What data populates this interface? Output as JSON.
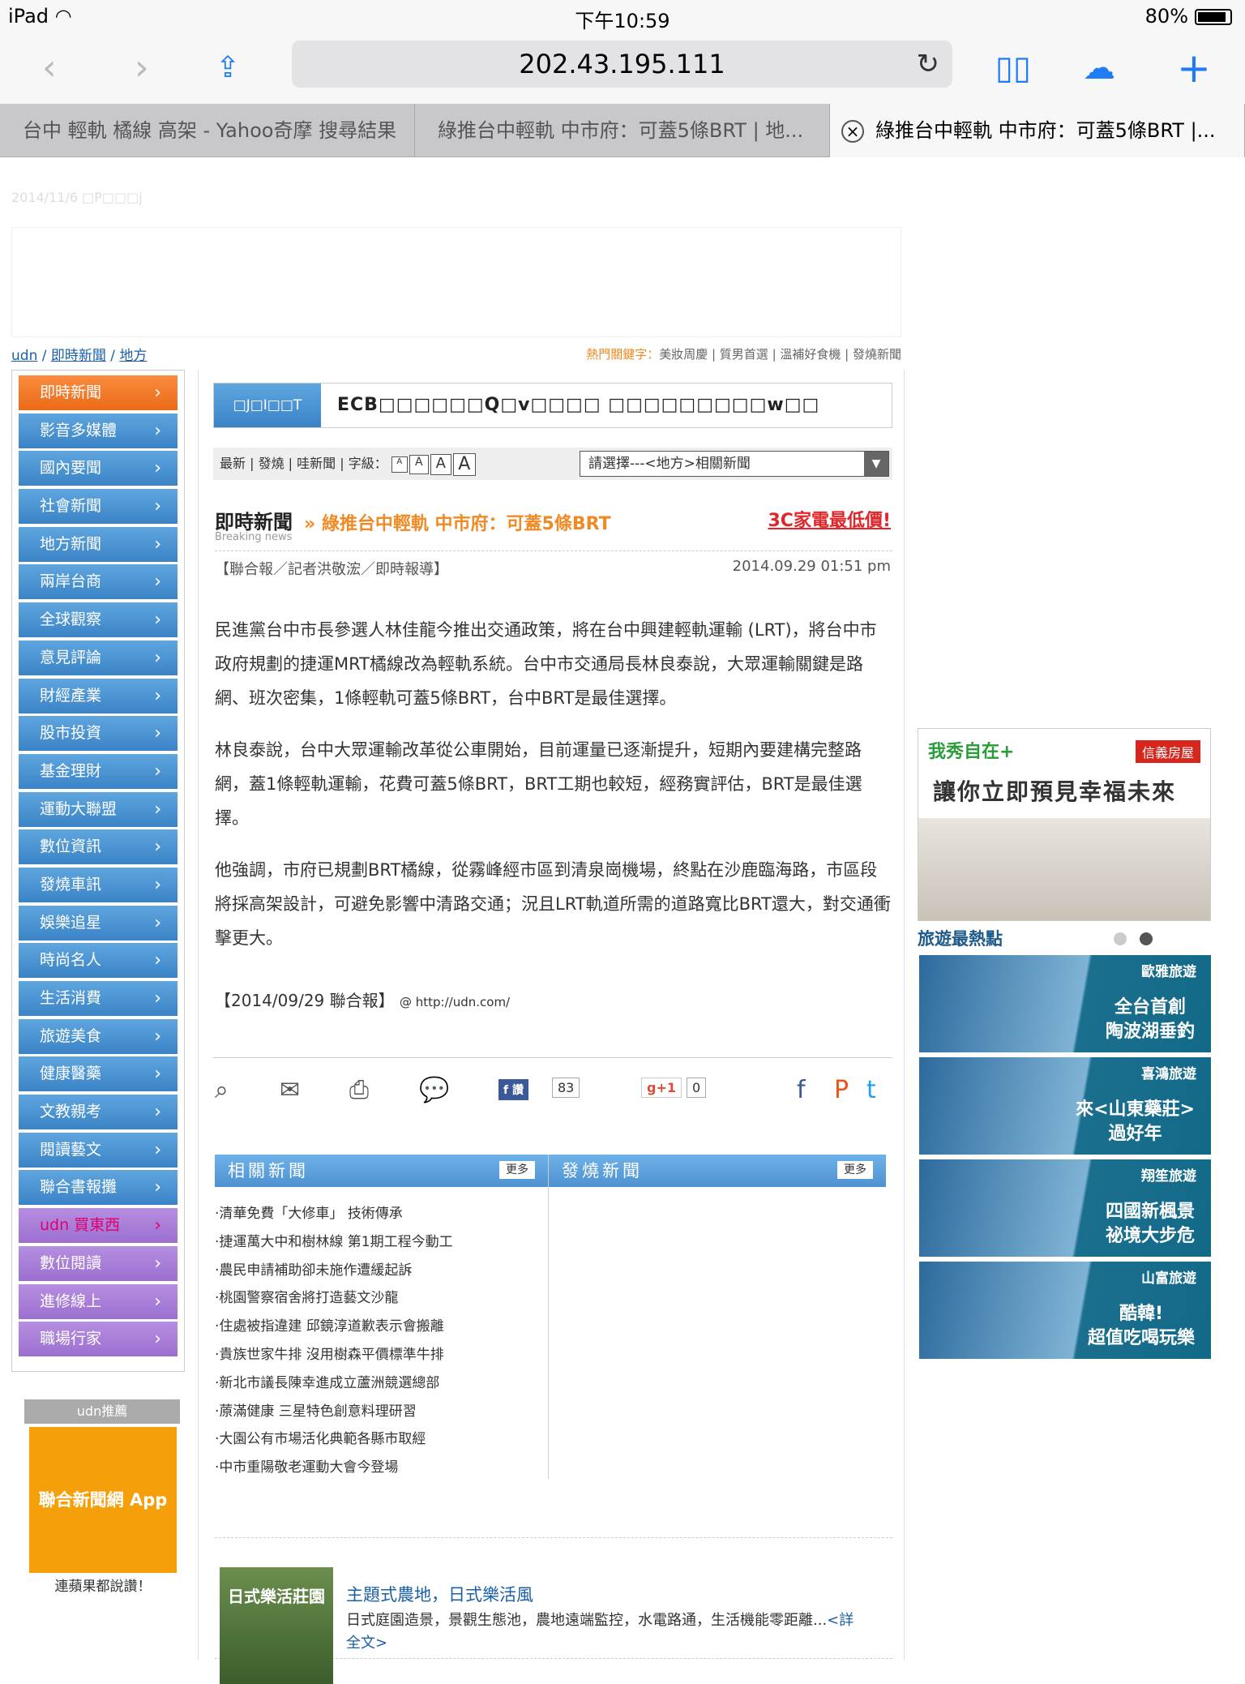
{
  "status": {
    "device": "iPad",
    "time": "下午10:59",
    "battery": "80%"
  },
  "browser": {
    "url": "202.43.195.111"
  },
  "tabs": [
    {
      "label": "台中 輕軌 橘線 高架 - Yahoo奇摩 搜尋結果"
    },
    {
      "label": "綠推台中輕軌 中市府：可蓋5條BRT | 地..."
    },
    {
      "label": "綠推台中輕軌 中市府：可蓋5條BRT |..."
    }
  ],
  "site": {
    "date": "2014/11/6 □P□□□j"
  },
  "breadcrumb": {
    "a": "udn",
    "b": "即時新聞",
    "c": "地方"
  },
  "hot_keywords": {
    "label": "熱門關鍵字：",
    "items": "美妝周慶 | 質男首選 | 溫補好食機 | 發燒新聞"
  },
  "sidebar": {
    "items": [
      "即時新聞",
      "影音多媒體",
      "國內要聞",
      "社會新聞",
      "地方新聞",
      "兩岸台商",
      "全球觀察",
      "意見評論",
      "財經產業",
      "股市投資",
      "基金理財",
      "運動大聯盟",
      "數位資訊",
      "發燒車訊",
      "娛樂追星",
      "時尚名人",
      "生活消費",
      "旅遊美食",
      "健康醫藥",
      "文教親考",
      "閱讀藝文",
      "聯合書報攤",
      "udn 買東西",
      "數位閱讀",
      "進修線上",
      "職場行家"
    ],
    "rec_label": "udn推薦",
    "app_label": "聯合新聞網 App",
    "app_caption": "連蘋果都說讚！"
  },
  "article": {
    "project_label": "□J□I□□T",
    "project_text": "ECB□□□□□□Q□v□□□□ □□□□□□□□□w□□",
    "tools": "最新 | 發燒 | 哇新聞 | 字級：",
    "select": "請選擇---<地方>相關新聞",
    "breaking": "即時新聞",
    "breaking_sub": "Breaking news",
    "title": "綠推台中輕軌 中市府：可蓋5條BRT",
    "ad": "3C家電最低價!",
    "byline": "【聯合報／記者洪敬浤／即時報導】",
    "date": "2014.09.29 01:51 pm",
    "p1": "民進黨台中市長參選人林佳龍今推出交通政策，將在台中興建輕軌運輸 (LRT)，將台中市政府規劃的捷運MRT橘線改為輕軌系統。台中市交通局長林良泰說，大眾運輸關鍵是路網、班次密集，1條輕軌可蓋5條BRT，台中BRT是最佳選擇。",
    "p2": "林良泰說，台中大眾運輸改革從公車開始，目前運量已逐漸提升，短期內要建構完整路網，蓋1條輕軌運輸，花費可蓋5條BRT，BRT工期也較短，經務實評估，BRT是最佳選擇。",
    "p3": "他強調，市府已規劃BRT橘線，從霧峰經市區到清泉崗機場，終點在沙鹿臨海路，市區段將採高架設計，可避免影響中清路交通；況且LRT軌道所需的道路寬比BRT還大，對交通衝擊更大。",
    "footer": "【2014/09/29 聯合報】",
    "footer_url": "@ http://udn.com/",
    "fb_label": "讚",
    "fb_count": "83",
    "g_label": "g+1",
    "g_count": "0"
  },
  "related": {
    "title": "相關新聞",
    "hot_title": "發燒新聞",
    "more": "更多",
    "items": [
      "清華免費「大修車」 技術傳承",
      "捷運萬大中和樹林線 第1期工程今動工",
      "農民申請補助卻未施作遭緩起訴",
      "桃園警察宿舍將打造藝文沙龍",
      "住處被指違建 邱鏡淳道歉表示會搬離",
      "貴族世家牛排 沒用樹森平價標準牛排",
      "新北市議長陳幸進成立蘆洲競選總部",
      "蒝滿健康 三星特色創意料理研習",
      "大園公有市場活化典範各縣市取經",
      "中市重陽敬老運動大會今登場"
    ]
  },
  "feature": {
    "img_text": "日式樂活莊園",
    "title": "主題式農地，日式樂活風",
    "desc": "日式庭園造景，景觀生態池，農地遠端監控，水電路通，生活機能零距離...",
    "more": "<詳全文>"
  },
  "right_ad": {
    "logo1": "我秀自在+",
    "logo2": "信義房屋",
    "slogan": "讓你立即預見幸福未來"
  },
  "travel": {
    "title": "旅遊最熱點",
    "items": [
      {
        "agency": "歐雅旅遊",
        "line1": "全台首創",
        "line2": "陶波湖垂釣"
      },
      {
        "agency": "喜鴻旅遊",
        "line1": "來<山東藥莊>",
        "line2": "過好年"
      },
      {
        "agency": "翔笙旅遊",
        "line1": "四國新楓景",
        "line2": "祕境大步危"
      },
      {
        "agency": "山富旅遊",
        "line1": "酷韓!",
        "line2": "超值吃喝玩樂"
      }
    ]
  }
}
